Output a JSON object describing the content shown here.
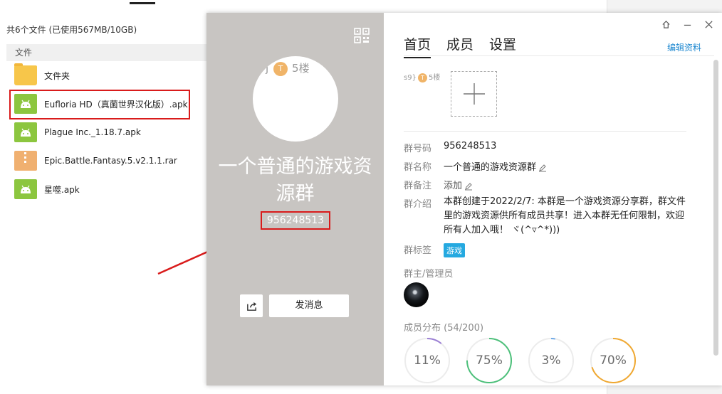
{
  "file_list": {
    "summary": "共6个文件 (已使用567MB/10GB)",
    "column_header": "文件",
    "items": [
      {
        "name": "文件夹",
        "type": "folder"
      },
      {
        "name": "Eufloria HD（真菌世界汉化版）.apk",
        "type": "apk"
      },
      {
        "name": "Plague Inc._1.18.7.apk",
        "type": "apk"
      },
      {
        "name": "Epic.Battle.Fantasy.5.v2.1.1.rar",
        "type": "rar"
      },
      {
        "name": "星噬.apk",
        "type": "apk"
      }
    ],
    "icons": {
      "folder": "folder-icon",
      "apk": "android-icon",
      "rar": "archive-icon"
    }
  },
  "dialog": {
    "left": {
      "avatar_text": "5楼",
      "avatar_badge": "T",
      "group_name": "一个普通的游戏资源群",
      "group_id": "956248513",
      "send_button": "发消息",
      "icons": {
        "qr": "qr-code-icon",
        "share": "share-icon"
      }
    },
    "tabs": [
      {
        "label": "首页",
        "active": true
      },
      {
        "label": "成员",
        "active": false
      },
      {
        "label": "设置",
        "active": false
      }
    ],
    "edit_profile": "编辑资料",
    "window_controls": {
      "pin": "pin-icon",
      "minimize": "minimize-icon",
      "close": "close-icon"
    },
    "photo_thumb_text": "5楼",
    "info": {
      "id_label": "群号码",
      "id_value": "956248513",
      "name_label": "群名称",
      "name_value": "一个普通的游戏资源群",
      "remark_label": "群备注",
      "remark_value": "添加",
      "intro_label": "群介绍",
      "intro_value": "本群创建于2022/2/7: 本群是一个游戏资源分享群，群文件里的游戏资源供所有成员共享！进入本群无任何限制，欢迎所有人加入哦！ ヾ(^▿^*)))",
      "tag_label": "群标签",
      "tag_value": "游戏",
      "admin_label": "群主/管理员",
      "members_label": "成员分布",
      "members_count": "(54/200)"
    },
    "stats": [
      {
        "label": "11%",
        "value": 11,
        "color": "#9b7fd4"
      },
      {
        "label": "75%",
        "value": 75,
        "color": "#4cc07a"
      },
      {
        "label": "3%",
        "value": 3,
        "color": "#6fa9e6"
      },
      {
        "label": "70%",
        "value": 70,
        "color": "#f0a830"
      }
    ]
  },
  "colors": {
    "highlight": "#d91b1b",
    "link": "#1e88d0",
    "tag": "#25a9e0",
    "left_panel": "#c8c5c2"
  }
}
